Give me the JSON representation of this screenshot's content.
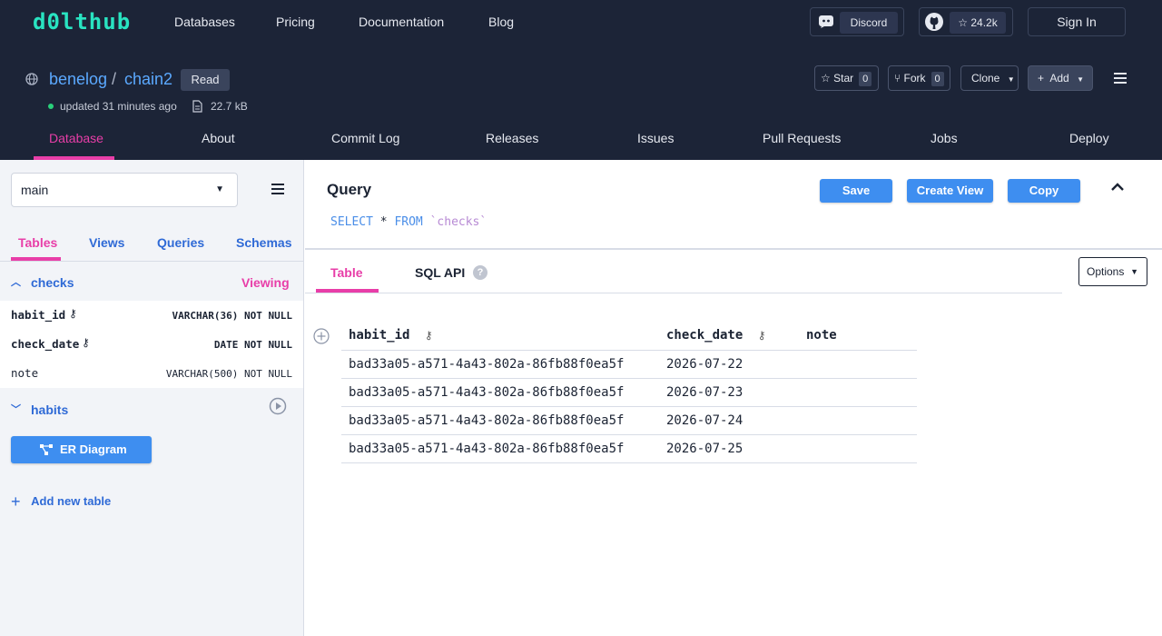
{
  "topnav": {
    "logo": "d0lthub",
    "links": [
      "Databases",
      "Pricing",
      "Documentation",
      "Blog"
    ],
    "discord_label": "Discord",
    "github_stars": "24.2k",
    "sign_in": "Sign In"
  },
  "repo": {
    "owner": "benelog",
    "separator": "/",
    "name": "chain2",
    "badge": "Read",
    "updated": "updated 31 minutes ago",
    "size": "22.7 kB",
    "star_label": "Star",
    "star_count": "0",
    "fork_label": "Fork",
    "fork_count": "0",
    "clone_label": "Clone",
    "add_label": "Add"
  },
  "repo_tabs": [
    "Database",
    "About",
    "Commit Log",
    "Releases",
    "Issues",
    "Pull Requests",
    "Jobs",
    "Deploy"
  ],
  "sidebar": {
    "branch": "main",
    "tabs": [
      "Tables",
      "Views",
      "Queries",
      "Schemas"
    ],
    "tables": [
      {
        "name": "checks",
        "status": "Viewing",
        "columns": [
          {
            "name": "habit_id",
            "type": "VARCHAR(36) NOT NULL"
          },
          {
            "name": "check_date",
            "type": "DATE NOT NULL"
          },
          {
            "name": "note",
            "type": "VARCHAR(500) NOT NULL"
          }
        ]
      },
      {
        "name": "habits"
      }
    ],
    "er_diagram": "ER Diagram",
    "add_table": "Add new table"
  },
  "query": {
    "title": "Query",
    "save": "Save",
    "create_view": "Create View",
    "copy": "Copy",
    "sql_keyword1": "SELECT",
    "sql_star": "*",
    "sql_keyword2": "FROM",
    "sql_table": "`checks`"
  },
  "result_tabs": [
    "Table",
    "SQL API"
  ],
  "options": "Options",
  "results": {
    "columns": [
      "habit_id",
      "check_date",
      "note"
    ],
    "rows": [
      [
        "bad33a05-a571-4a43-802a-86fb88f0ea5f",
        "2026-07-22",
        ""
      ],
      [
        "bad33a05-a571-4a43-802a-86fb88f0ea5f",
        "2026-07-23",
        ""
      ],
      [
        "bad33a05-a571-4a43-802a-86fb88f0ea5f",
        "2026-07-24",
        ""
      ],
      [
        "bad33a05-a571-4a43-802a-86fb88f0ea5f",
        "2026-07-25",
        ""
      ]
    ]
  },
  "colors": {
    "nav_bg": "#1c2437",
    "accent_pink": "#e83ea8",
    "button_blue": "#3e8ef0",
    "link_blue": "#5ba9ff",
    "logo_teal": "#29e3c1"
  }
}
